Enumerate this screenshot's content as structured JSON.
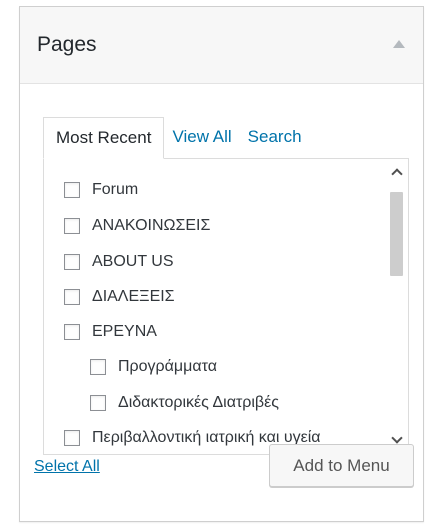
{
  "panel": {
    "title": "Pages"
  },
  "tabs": [
    {
      "label": "Most Recent",
      "active": true
    },
    {
      "label": "View All",
      "active": false
    },
    {
      "label": "Search",
      "active": false
    }
  ],
  "items": [
    {
      "label": "Forum",
      "level": 0,
      "checked": false
    },
    {
      "label": "ΑΝΑΚΟΙΝΩΣΕΙΣ",
      "level": 0,
      "checked": false
    },
    {
      "label": "ABOUT US",
      "level": 0,
      "checked": false
    },
    {
      "label": "ΔΙΑΛΕΞΕΙΣ",
      "level": 0,
      "checked": false
    },
    {
      "label": "ΕΡΕΥΝΑ",
      "level": 0,
      "checked": false
    },
    {
      "label": "Προγράμματα",
      "level": 1,
      "checked": false
    },
    {
      "label": "Διδακτορικές Διατριβές",
      "level": 1,
      "checked": false
    },
    {
      "label": "Περιβαλλοντική ιατρική και υγεία",
      "level": 0,
      "checked": false
    }
  ],
  "footer": {
    "select_all": "Select All",
    "add_button": "Add to Menu"
  },
  "colors": {
    "link": "#0073aa",
    "text": "#32373c",
    "header_bg": "#f7f7f7"
  }
}
